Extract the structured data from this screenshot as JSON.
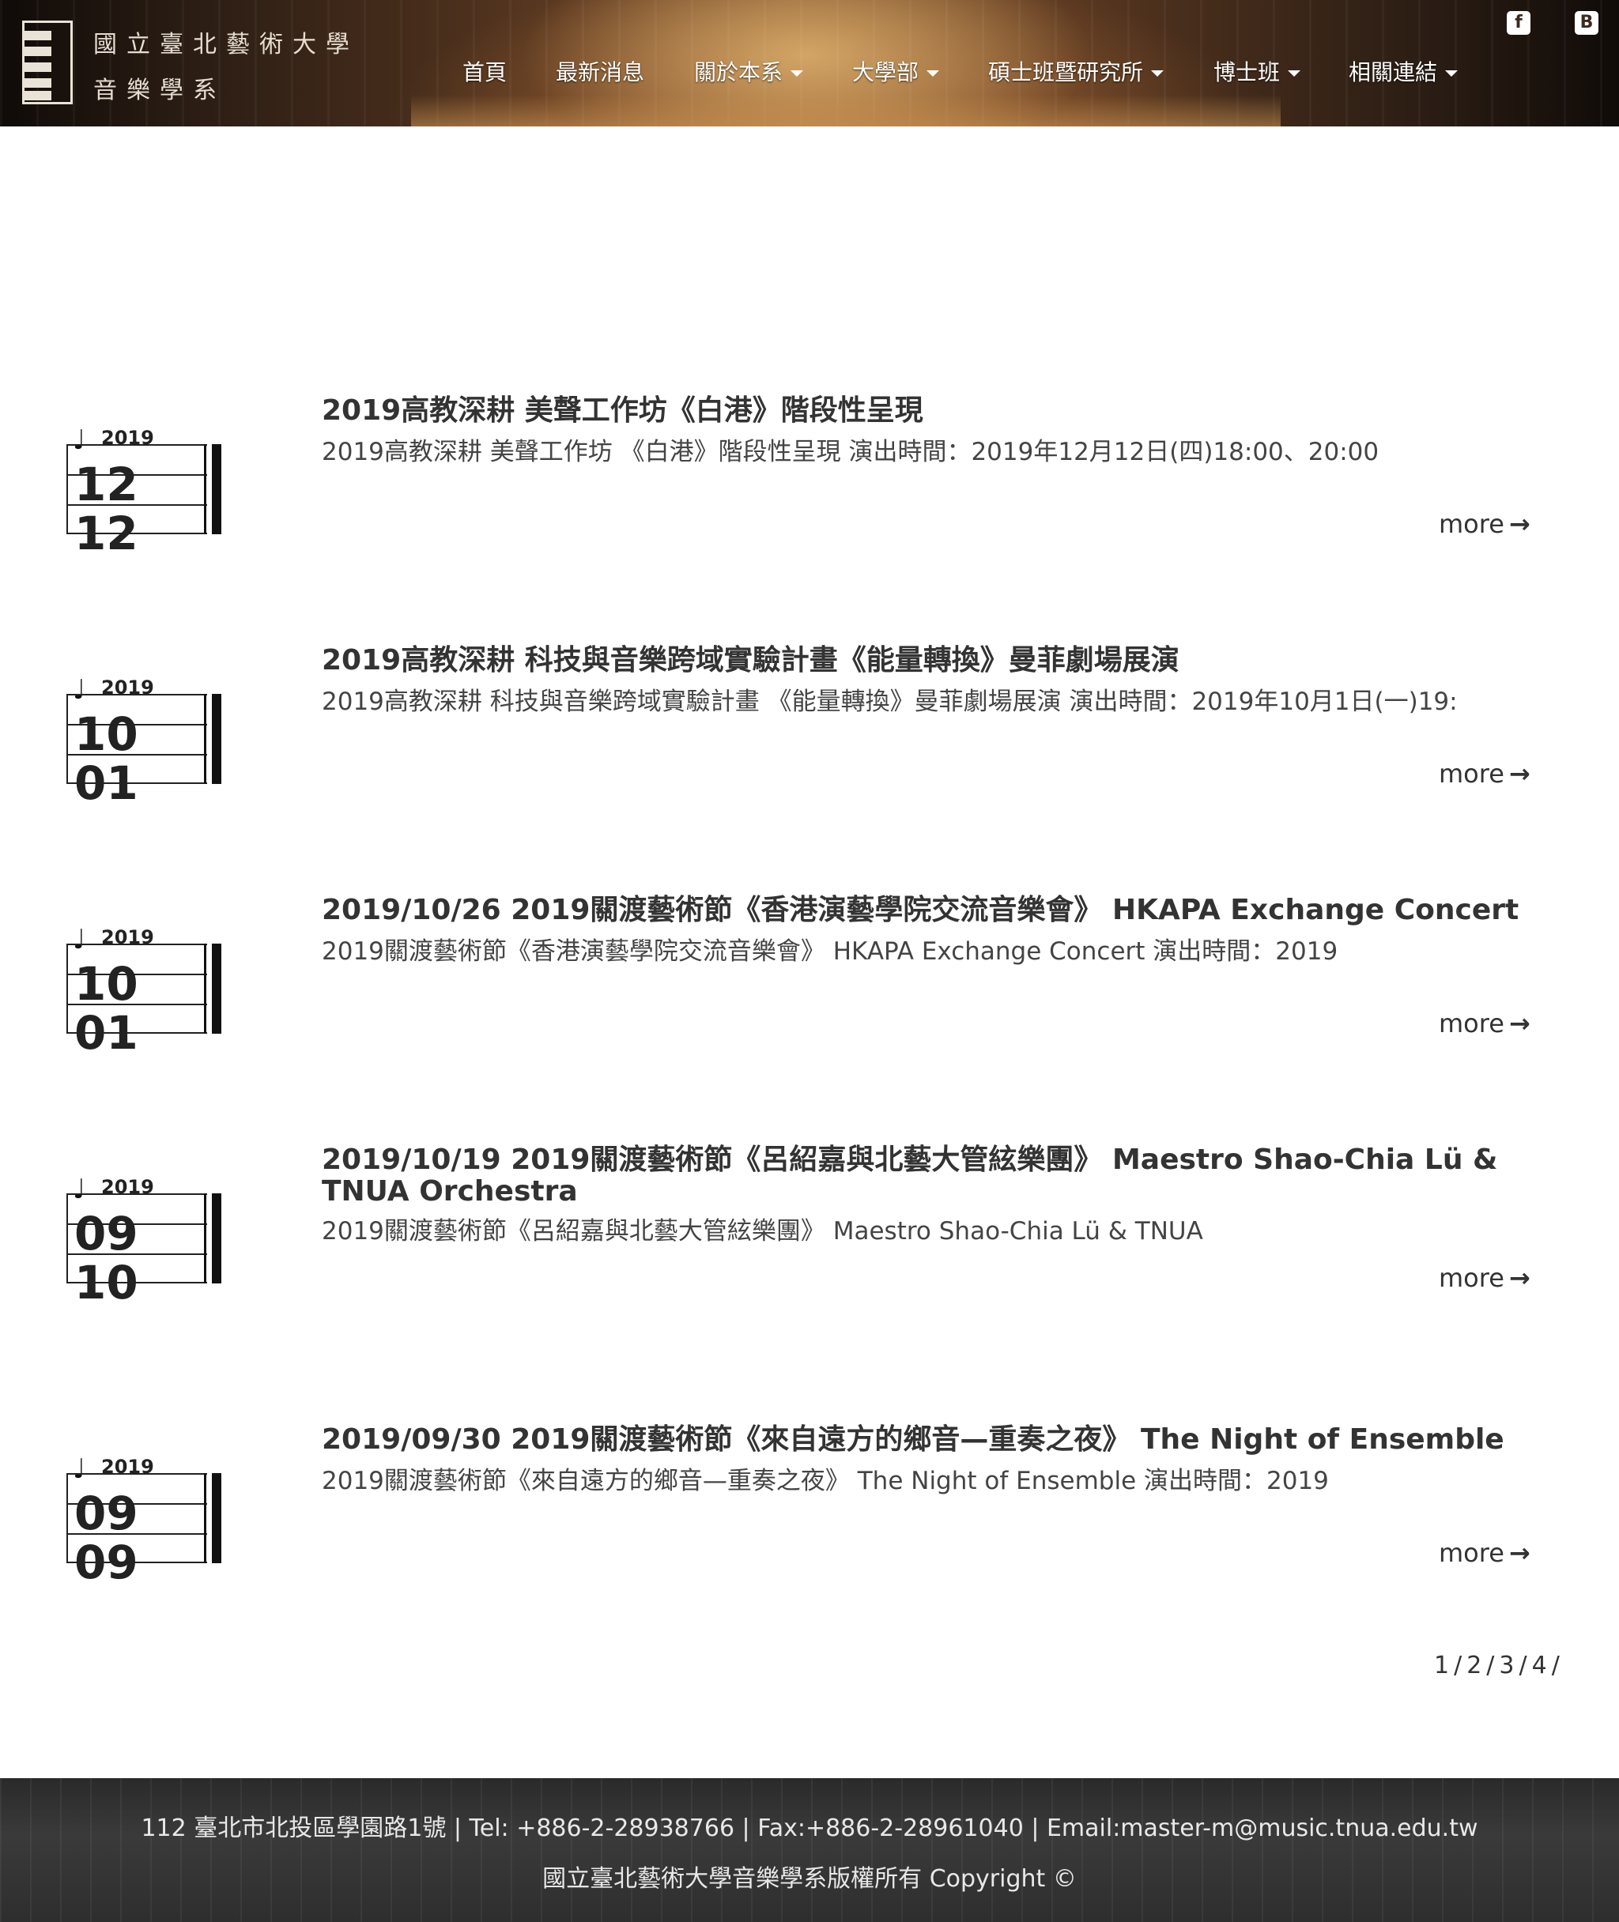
{
  "header": {
    "logo_line1": "國立臺北藝術大學",
    "logo_line2": "音樂學系",
    "nav": [
      {
        "label": "首頁",
        "dropdown": false
      },
      {
        "label": "最新消息",
        "dropdown": false
      },
      {
        "label": "關於本系",
        "dropdown": true
      },
      {
        "label": "大學部",
        "dropdown": true
      },
      {
        "label": "碩士班暨研究所",
        "dropdown": true
      },
      {
        "label": "博士班",
        "dropdown": true
      },
      {
        "label": "相關連結",
        "dropdown": true
      }
    ],
    "social": [
      {
        "icon": "facebook-icon",
        "glyph": "f"
      },
      {
        "icon": "blogger-icon",
        "glyph": "B"
      }
    ]
  },
  "news": [
    {
      "year": "2019",
      "month": "12",
      "day": "12",
      "title": "2019高教深耕 美聲工作坊《白港》階段性呈現",
      "summary": "2019高教深耕 美聲工作坊 《白港》階段性呈現 演出時間：2019年12月12日(四)18:00、20:00",
      "more": "more"
    },
    {
      "year": "2019",
      "month": "10",
      "day": "01",
      "title": "2019高教深耕 科技與音樂跨域實驗計畫《能量轉換》曼菲劇場展演",
      "summary": "2019高教深耕 科技與音樂跨域實驗計畫 《能量轉換》曼菲劇場展演 演出時間：2019年10月1日(一)19:",
      "more": "more"
    },
    {
      "year": "2019",
      "month": "10",
      "day": "01",
      "title": "2019/10/26 2019關渡藝術節《香港演藝學院交流音樂會》 HKAPA Exchange Concert",
      "summary": "2019關渡藝術節《香港演藝學院交流音樂會》 HKAPA Exchange Concert 演出時間：2019",
      "more": "more"
    },
    {
      "year": "2019",
      "month": "09",
      "day": "10",
      "title": "2019/10/19 2019關渡藝術節《呂紹嘉與北藝大管絃樂團》 Maestro Shao-Chia Lü & TNUA Orchestra",
      "summary": "2019關渡藝術節《呂紹嘉與北藝大管絃樂團》 Maestro Shao-Chia Lü & TNUA",
      "more": "more"
    },
    {
      "year": "2019",
      "month": "09",
      "day": "09",
      "title": "2019/09/30 2019關渡藝術節《來自遠方的鄉音—重奏之夜》 The Night of Ensemble",
      "summary": "2019關渡藝術節《來自遠方的鄉音—重奏之夜》 The Night of Ensemble 演出時間：2019",
      "more": "more"
    }
  ],
  "pagination": {
    "pages": [
      "1",
      "2",
      "3",
      "4"
    ],
    "separator": "/"
  },
  "footer": {
    "line1": "112 臺北市北投區學園路1號 | Tel: +886-2-28938766 | Fax:+886-2-28961040 | Email:master-m@music.tnua.edu.tw",
    "line2": "國立臺北藝術大學音樂學系版權所有 Copyright ©"
  }
}
